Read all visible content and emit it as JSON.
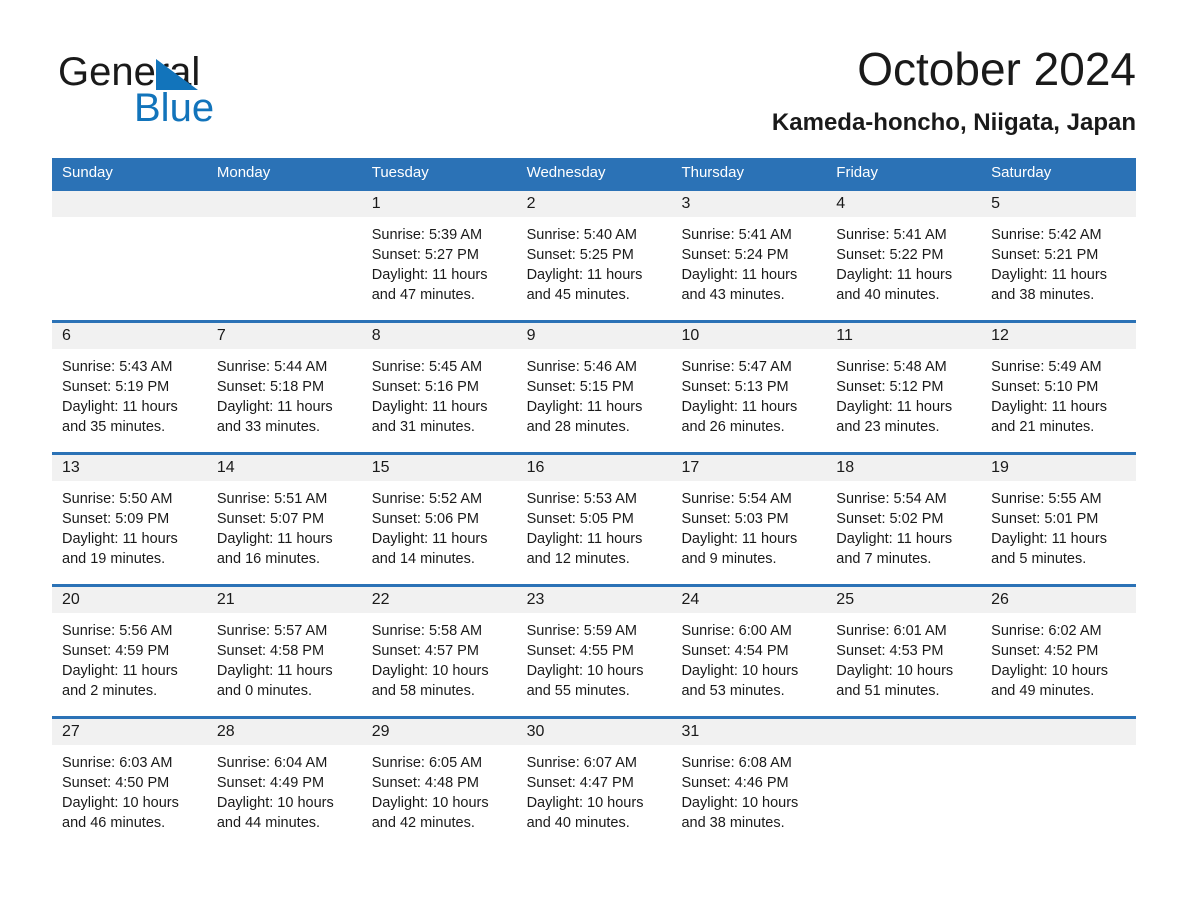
{
  "brand": {
    "name_part1": "General",
    "name_part2": "Blue",
    "logo_icon": "triangle-flag-icon",
    "accent_color": "#1274bb"
  },
  "header": {
    "month_title": "October 2024",
    "location": "Kameda-honcho, Niigata, Japan"
  },
  "calendar": {
    "header_bg": "#2b72b6",
    "datebar_bg": "#f1f1f1",
    "weekday_headers": [
      "Sunday",
      "Monday",
      "Tuesday",
      "Wednesday",
      "Thursday",
      "Friday",
      "Saturday"
    ],
    "weeks": [
      {
        "days": [
          {
            "num": "",
            "info": ""
          },
          {
            "num": "",
            "info": ""
          },
          {
            "num": "1",
            "info": "Sunrise: 5:39 AM\nSunset: 5:27 PM\nDaylight: 11 hours\nand 47 minutes."
          },
          {
            "num": "2",
            "info": "Sunrise: 5:40 AM\nSunset: 5:25 PM\nDaylight: 11 hours\nand 45 minutes."
          },
          {
            "num": "3",
            "info": "Sunrise: 5:41 AM\nSunset: 5:24 PM\nDaylight: 11 hours\nand 43 minutes."
          },
          {
            "num": "4",
            "info": "Sunrise: 5:41 AM\nSunset: 5:22 PM\nDaylight: 11 hours\nand 40 minutes."
          },
          {
            "num": "5",
            "info": "Sunrise: 5:42 AM\nSunset: 5:21 PM\nDaylight: 11 hours\nand 38 minutes."
          }
        ]
      },
      {
        "days": [
          {
            "num": "6",
            "info": "Sunrise: 5:43 AM\nSunset: 5:19 PM\nDaylight: 11 hours\nand 35 minutes."
          },
          {
            "num": "7",
            "info": "Sunrise: 5:44 AM\nSunset: 5:18 PM\nDaylight: 11 hours\nand 33 minutes."
          },
          {
            "num": "8",
            "info": "Sunrise: 5:45 AM\nSunset: 5:16 PM\nDaylight: 11 hours\nand 31 minutes."
          },
          {
            "num": "9",
            "info": "Sunrise: 5:46 AM\nSunset: 5:15 PM\nDaylight: 11 hours\nand 28 minutes."
          },
          {
            "num": "10",
            "info": "Sunrise: 5:47 AM\nSunset: 5:13 PM\nDaylight: 11 hours\nand 26 minutes."
          },
          {
            "num": "11",
            "info": "Sunrise: 5:48 AM\nSunset: 5:12 PM\nDaylight: 11 hours\nand 23 minutes."
          },
          {
            "num": "12",
            "info": "Sunrise: 5:49 AM\nSunset: 5:10 PM\nDaylight: 11 hours\nand 21 minutes."
          }
        ]
      },
      {
        "days": [
          {
            "num": "13",
            "info": "Sunrise: 5:50 AM\nSunset: 5:09 PM\nDaylight: 11 hours\nand 19 minutes."
          },
          {
            "num": "14",
            "info": "Sunrise: 5:51 AM\nSunset: 5:07 PM\nDaylight: 11 hours\nand 16 minutes."
          },
          {
            "num": "15",
            "info": "Sunrise: 5:52 AM\nSunset: 5:06 PM\nDaylight: 11 hours\nand 14 minutes."
          },
          {
            "num": "16",
            "info": "Sunrise: 5:53 AM\nSunset: 5:05 PM\nDaylight: 11 hours\nand 12 minutes."
          },
          {
            "num": "17",
            "info": "Sunrise: 5:54 AM\nSunset: 5:03 PM\nDaylight: 11 hours\nand 9 minutes."
          },
          {
            "num": "18",
            "info": "Sunrise: 5:54 AM\nSunset: 5:02 PM\nDaylight: 11 hours\nand 7 minutes."
          },
          {
            "num": "19",
            "info": "Sunrise: 5:55 AM\nSunset: 5:01 PM\nDaylight: 11 hours\nand 5 minutes."
          }
        ]
      },
      {
        "days": [
          {
            "num": "20",
            "info": "Sunrise: 5:56 AM\nSunset: 4:59 PM\nDaylight: 11 hours\nand 2 minutes."
          },
          {
            "num": "21",
            "info": "Sunrise: 5:57 AM\nSunset: 4:58 PM\nDaylight: 11 hours\nand 0 minutes."
          },
          {
            "num": "22",
            "info": "Sunrise: 5:58 AM\nSunset: 4:57 PM\nDaylight: 10 hours\nand 58 minutes."
          },
          {
            "num": "23",
            "info": "Sunrise: 5:59 AM\nSunset: 4:55 PM\nDaylight: 10 hours\nand 55 minutes."
          },
          {
            "num": "24",
            "info": "Sunrise: 6:00 AM\nSunset: 4:54 PM\nDaylight: 10 hours\nand 53 minutes."
          },
          {
            "num": "25",
            "info": "Sunrise: 6:01 AM\nSunset: 4:53 PM\nDaylight: 10 hours\nand 51 minutes."
          },
          {
            "num": "26",
            "info": "Sunrise: 6:02 AM\nSunset: 4:52 PM\nDaylight: 10 hours\nand 49 minutes."
          }
        ]
      },
      {
        "days": [
          {
            "num": "27",
            "info": "Sunrise: 6:03 AM\nSunset: 4:50 PM\nDaylight: 10 hours\nand 46 minutes."
          },
          {
            "num": "28",
            "info": "Sunrise: 6:04 AM\nSunset: 4:49 PM\nDaylight: 10 hours\nand 44 minutes."
          },
          {
            "num": "29",
            "info": "Sunrise: 6:05 AM\nSunset: 4:48 PM\nDaylight: 10 hours\nand 42 minutes."
          },
          {
            "num": "30",
            "info": "Sunrise: 6:07 AM\nSunset: 4:47 PM\nDaylight: 10 hours\nand 40 minutes."
          },
          {
            "num": "31",
            "info": "Sunrise: 6:08 AM\nSunset: 4:46 PM\nDaylight: 10 hours\nand 38 minutes."
          },
          {
            "num": "",
            "info": ""
          },
          {
            "num": "",
            "info": ""
          }
        ]
      }
    ]
  }
}
